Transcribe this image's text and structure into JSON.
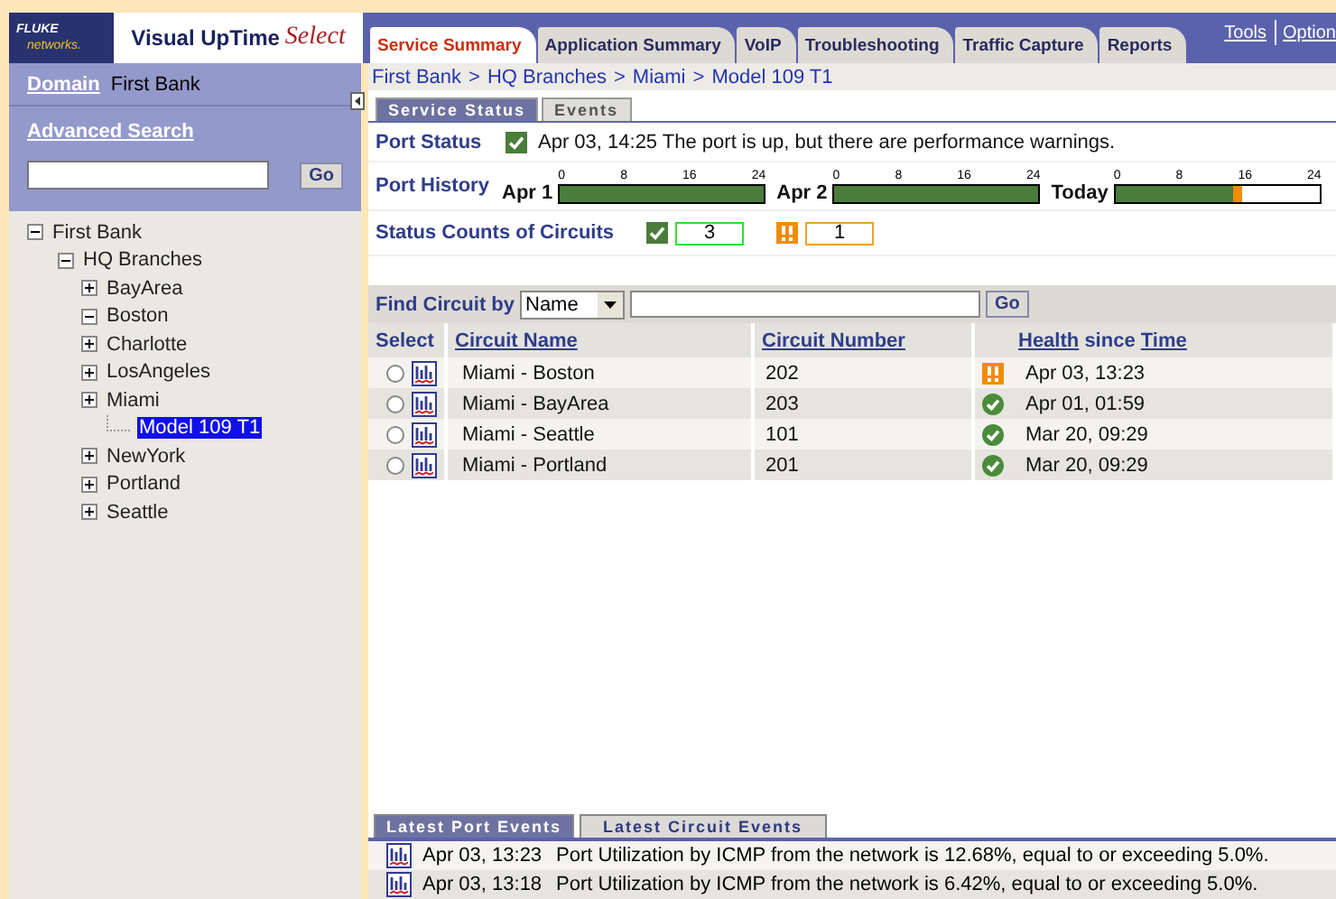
{
  "header": {
    "brand_top": "FLUKE",
    "brand_bottom": "networks.",
    "product": "Visual UpTime",
    "product_edition": "Select"
  },
  "tabs": [
    {
      "label": "Service Summary",
      "selected": true
    },
    {
      "label": "Application Summary",
      "selected": false
    },
    {
      "label": "VoIP",
      "selected": false
    },
    {
      "label": "Troubleshooting",
      "selected": false
    },
    {
      "label": "Traffic Capture",
      "selected": false
    },
    {
      "label": "Reports",
      "selected": false
    }
  ],
  "top_links": [
    "Tools",
    "Option"
  ],
  "sidebar": {
    "domain_label": "Domain",
    "domain_value": "First Bank",
    "advanced_search": "Advanced Search",
    "search_button": "Go",
    "tree": [
      {
        "label": "First Bank",
        "expanded": true,
        "selected": false,
        "children": [
          {
            "label": "HQ Branches",
            "expanded": true,
            "selected": false,
            "children": [
              {
                "label": "BayArea",
                "expanded": false,
                "selected": false
              },
              {
                "label": "Boston",
                "expanded": true,
                "selected": false
              },
              {
                "label": "Charlotte",
                "expanded": false,
                "selected": false
              },
              {
                "label": "LosAngeles",
                "expanded": false,
                "selected": false
              },
              {
                "label": "Miami",
                "expanded": false,
                "selected": false,
                "children": [
                  {
                    "label": "Model 109 T1",
                    "selected": true
                  }
                ]
              },
              {
                "label": "NewYork",
                "expanded": false,
                "selected": false
              },
              {
                "label": "Portland",
                "expanded": false,
                "selected": false
              },
              {
                "label": "Seattle",
                "expanded": false,
                "selected": false
              }
            ]
          }
        ]
      }
    ]
  },
  "breadcrumb": [
    {
      "label": "First Bank"
    },
    {
      "separator": ">",
      "label": "HQ Branches"
    },
    {
      "separator": ">",
      "label": "Miami"
    },
    {
      "separator": ">",
      "label": "Model 109 T1"
    }
  ],
  "subtabs": [
    {
      "label": "Service Status",
      "selected": true
    },
    {
      "label": "Events",
      "selected": false
    }
  ],
  "port_status": {
    "label": "Port Status",
    "kind": "ok",
    "text": "Apr 03, 14:25 The port is up, but there are performance warnings."
  },
  "port_history": {
    "label": "Port History",
    "days": [
      {
        "label": "Apr 1",
        "ticks": [
          "0",
          "8",
          "16",
          "24"
        ],
        "segments": [
          {
            "kind": "ok",
            "level": 1.0
          }
        ]
      },
      {
        "label": "Apr 2",
        "ticks": [
          "0",
          "8",
          "16",
          "24"
        ],
        "segments": [
          {
            "kind": "ok",
            "level": 1.0
          }
        ]
      },
      {
        "label": "Today",
        "ticks": [
          "0",
          "8",
          "16",
          "24"
        ],
        "segments": [
          {
            "kind": "ok",
            "level": 0.575
          },
          {
            "kind": "warning",
            "level": 0.045
          }
        ]
      }
    ]
  },
  "status_counts": {
    "label": "Status Counts of Circuits",
    "counts": [
      {
        "kind": "ok",
        "value": "3"
      },
      {
        "kind": "warning",
        "value": "1"
      }
    ]
  },
  "find": {
    "label": "Find Circuit by",
    "field": "Name",
    "button": "Go"
  },
  "table": {
    "columns": [
      "Select",
      "Circuit Name",
      "Circuit Number",
      "Health",
      "since",
      "Time"
    ],
    "rows": [
      {
        "selected": false,
        "name": "Miami - Boston",
        "number": "202",
        "kind": "warning",
        "time": "Apr 03, 13:23"
      },
      {
        "selected": false,
        "name": "Miami - BayArea",
        "number": "203",
        "kind": "ok",
        "time": "Apr 01, 01:59"
      },
      {
        "selected": false,
        "name": "Miami - Seattle",
        "number": "101",
        "kind": "ok",
        "time": "Mar 20, 09:29"
      },
      {
        "selected": false,
        "name": "Miami - Portland",
        "number": "201",
        "kind": "ok",
        "time": "Mar 20, 09:29"
      }
    ]
  },
  "event_tabs": [
    {
      "label": "Latest Port Events",
      "selected": true
    },
    {
      "label": "Latest Circuit Events",
      "selected": false
    }
  ],
  "events": [
    {
      "time": "Apr 03, 13:23",
      "text": "Port Utilization by ICMP from the network is 12.68%, equal to or exceeding 5.0%."
    },
    {
      "time": "Apr 03, 13:18",
      "text": "Port Utilization by ICMP from the network is 6.42%, equal to or exceeding 5.0%."
    }
  ]
}
